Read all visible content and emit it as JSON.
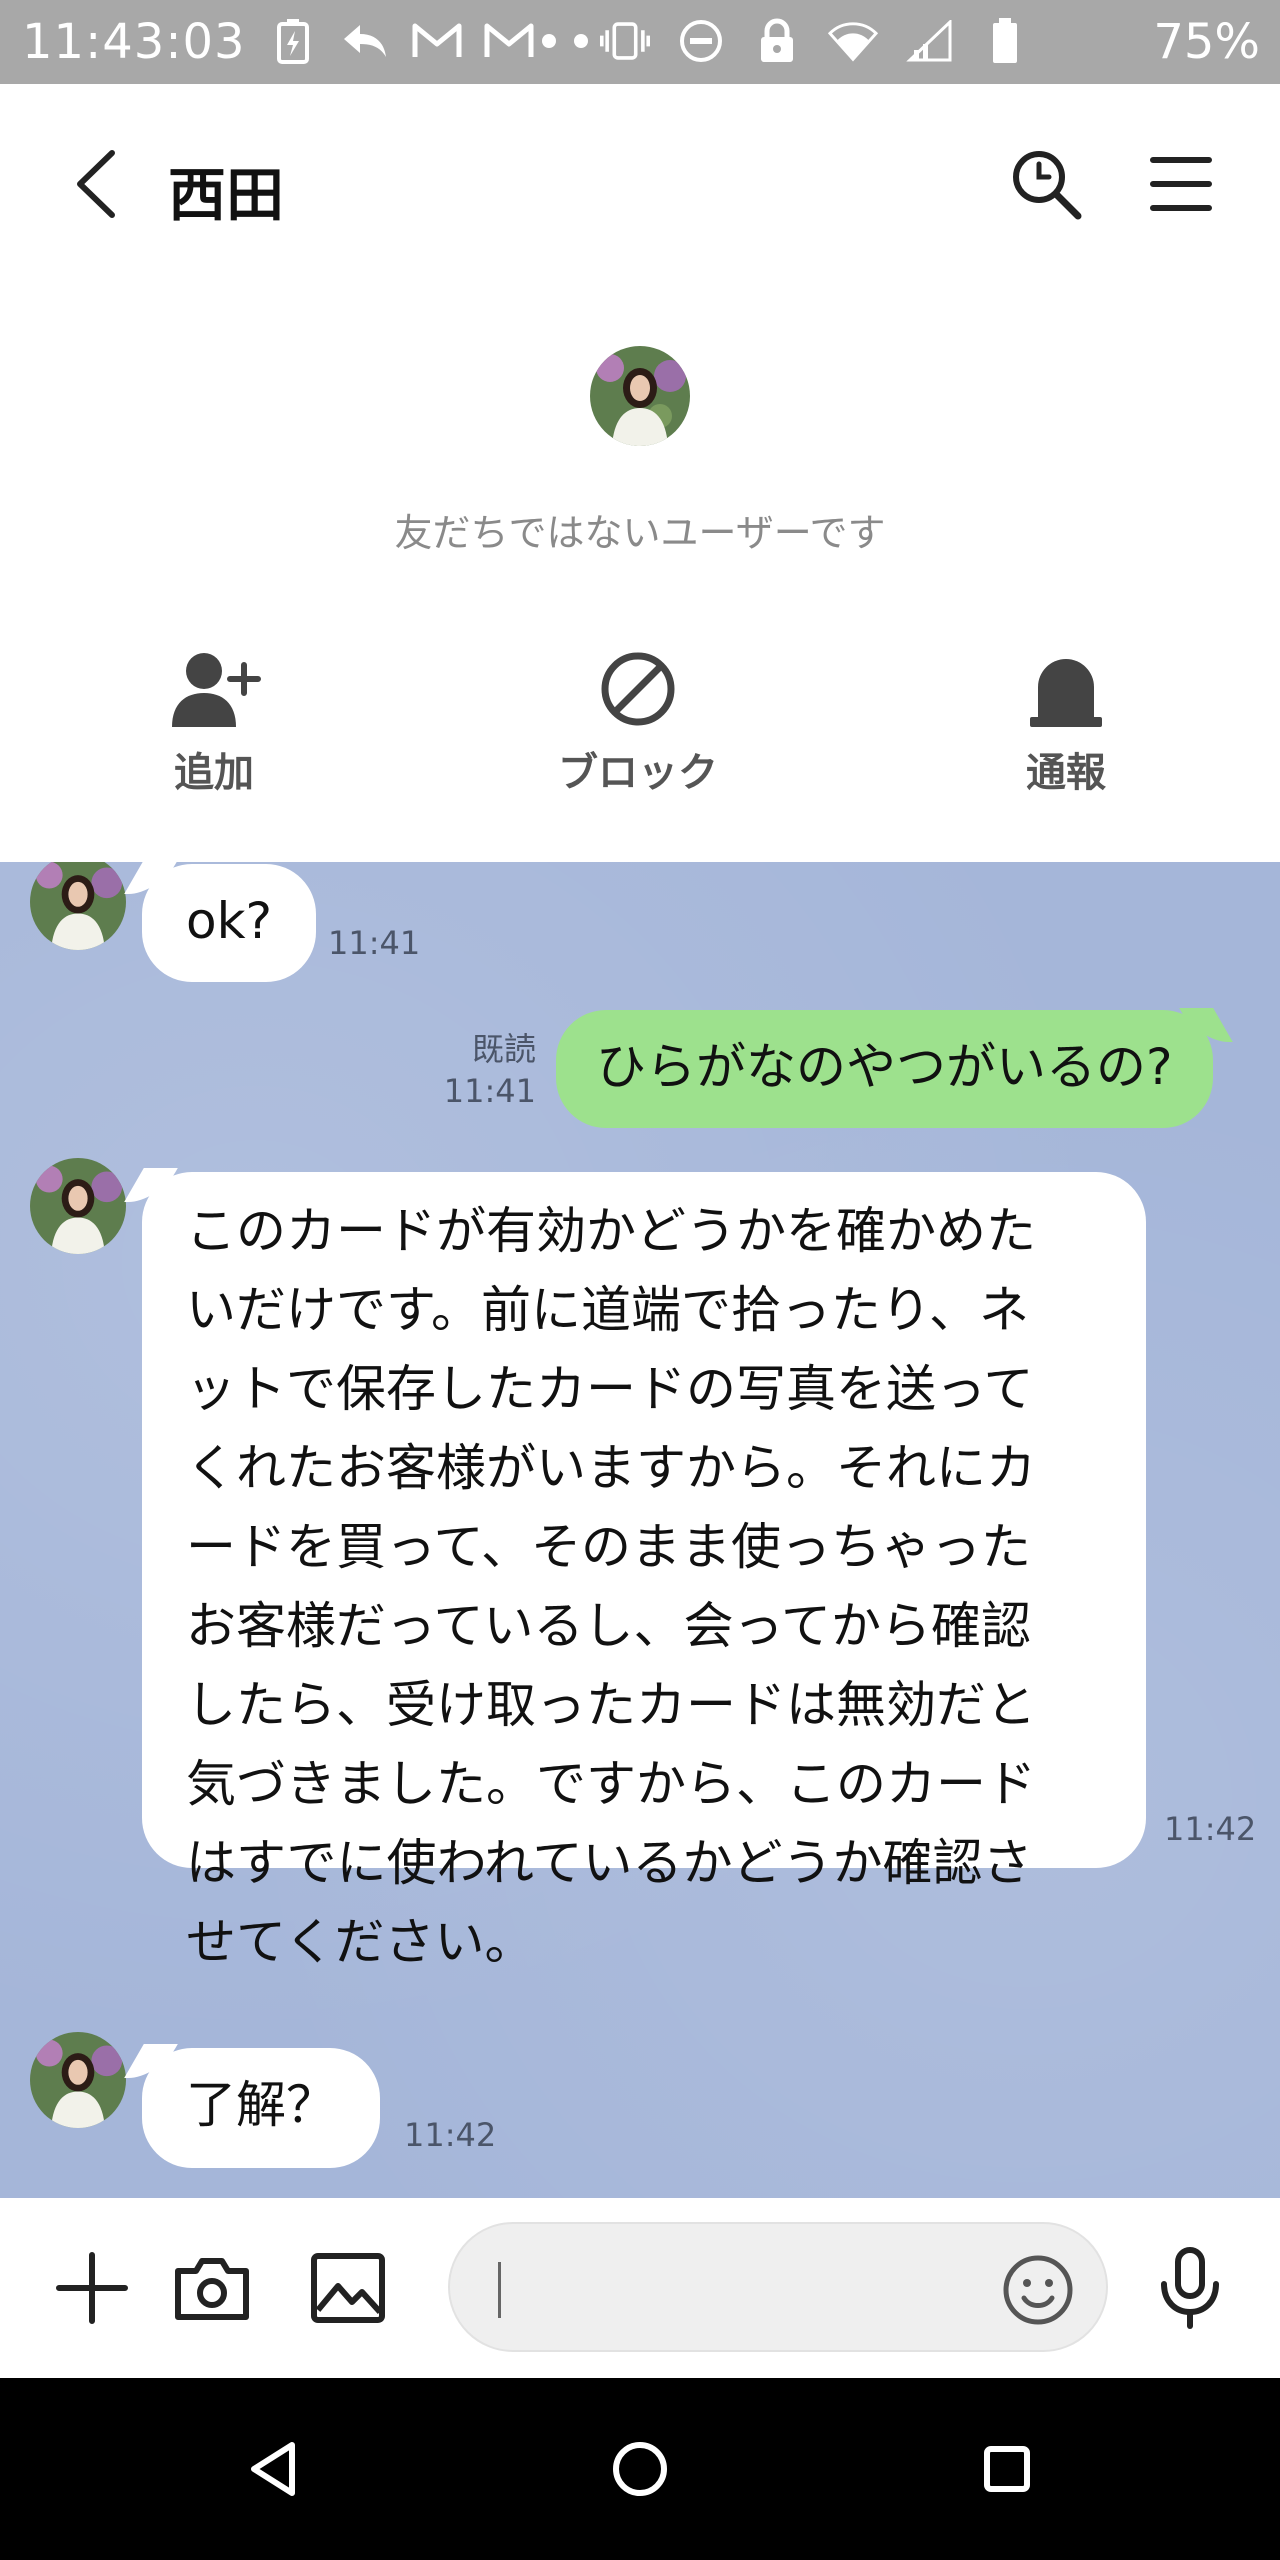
{
  "status_bar": {
    "time": "11:43:03",
    "battery": "75%",
    "left_icons": [
      "battery-saver-icon",
      "reply-icon",
      "gmail-icon",
      "gmail-icon",
      "dot-icon"
    ],
    "right_icons": [
      "dot-icon",
      "vibrate-icon",
      "do-not-disturb-icon",
      "lock-icon",
      "wifi-icon",
      "signal-icon",
      "battery-icon"
    ]
  },
  "header": {
    "title": "西田"
  },
  "profile": {
    "not_friend_text": "友だちではないユーザーです",
    "actions": [
      {
        "label": "追加",
        "icon": "add-friend-icon"
      },
      {
        "label": "ブロック",
        "icon": "block-icon"
      },
      {
        "label": "通報",
        "icon": "report-icon"
      }
    ]
  },
  "messages": [
    {
      "direction": "in",
      "text": "ok?",
      "time": "11:41"
    },
    {
      "direction": "out",
      "text": "ひらがなのやつがいるの?",
      "read": "既読",
      "time": "11:41"
    },
    {
      "direction": "in",
      "lines": [
        "このカードが有効かどうかを確かめた",
        "いだけです。前に道端で拾ったり、ネ",
        "ットで保存したカードの写真を送って",
        "くれたお客様がいますから。それにカ",
        "ードを買って、そのまま使っちゃった",
        "お客様だっているし、会ってから確認",
        "したら、受け取ったカードは無効だと",
        "気づきました。ですから、このカード",
        "はすでに使われているかどうか確認さ",
        "せてください。"
      ],
      "time": "11:42"
    },
    {
      "direction": "in",
      "text": "了解？",
      "time": "11:42"
    }
  ],
  "input": {
    "placeholder": ""
  },
  "colors": {
    "chat_background": "#a5b6d9",
    "outgoing_bubble": "#9de18d",
    "incoming_bubble": "#ffffff"
  }
}
